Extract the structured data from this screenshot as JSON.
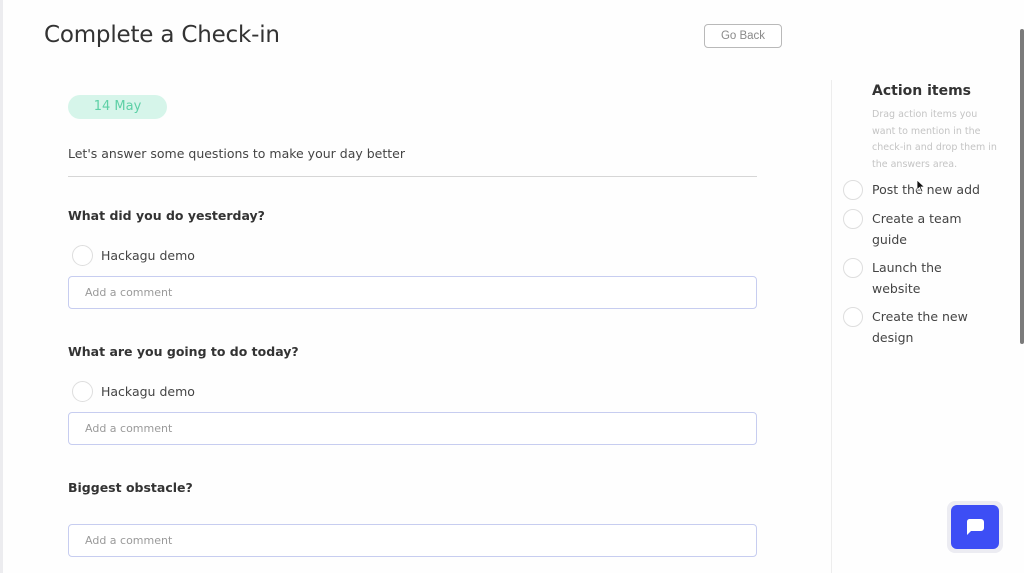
{
  "header": {
    "title": "Complete a Check-in",
    "go_back_label": "Go Back"
  },
  "checkin": {
    "date": "14 May",
    "intro": "Let's answer some questions to make your day better",
    "questions": [
      {
        "question": "What did you do yesterday?",
        "answers": [
          {
            "label": "Hackagu demo"
          }
        ],
        "comment": {
          "placeholder": "Add a comment",
          "value": ""
        }
      },
      {
        "question": "What are you going to do today?",
        "answers": [
          {
            "label": "Hackagu demo"
          }
        ],
        "comment": {
          "placeholder": "Add a comment",
          "value": ""
        }
      },
      {
        "question": "Biggest obstacle?",
        "answers": [],
        "comment": {
          "placeholder": "Add a comment",
          "value": ""
        }
      }
    ]
  },
  "sidebar": {
    "title": "Action items",
    "hint": "Drag action items you want to mention in the check-in and drop them in the answers area.",
    "items": [
      {
        "label": "Post the new add"
      },
      {
        "label": "Create a team guide"
      },
      {
        "label": "Launch the website"
      },
      {
        "label": "Create the new design"
      }
    ]
  },
  "chat": {
    "icon": "chat-bubble-icon"
  },
  "colors": {
    "accent": "#3d4ef5",
    "date_pill_bg": "#d6f5ea",
    "date_pill_text": "#5dd0a6",
    "input_border": "#c7cdf0"
  }
}
